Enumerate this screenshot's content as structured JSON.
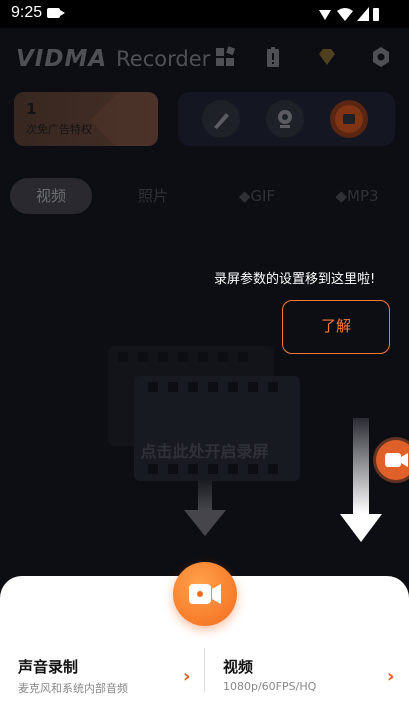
{
  "status_bar": {
    "time": "9:25"
  },
  "header": {
    "logo_brand": "VIDMA",
    "logo_suffix": "Recorder"
  },
  "promo": {
    "count": "1",
    "label": "次免广告特权"
  },
  "tabs": [
    {
      "label": "视频"
    },
    {
      "label": "照片"
    },
    {
      "label": "GIF"
    },
    {
      "label": "MP3"
    }
  ],
  "empty_state": {
    "text": "点击此处开启录屏"
  },
  "tooltip": {
    "text": "录屏参数的设置移到这里啦!",
    "confirm_label": "了解"
  },
  "bottom_sheet": {
    "audio": {
      "title": "声音录制",
      "subtitle": "麦克风和系统内部音频"
    },
    "video": {
      "title": "视频",
      "subtitle": "1080p/60FPS/HQ"
    }
  },
  "colors": {
    "accent": "#f26a1d",
    "outline": "#f07a3c"
  }
}
